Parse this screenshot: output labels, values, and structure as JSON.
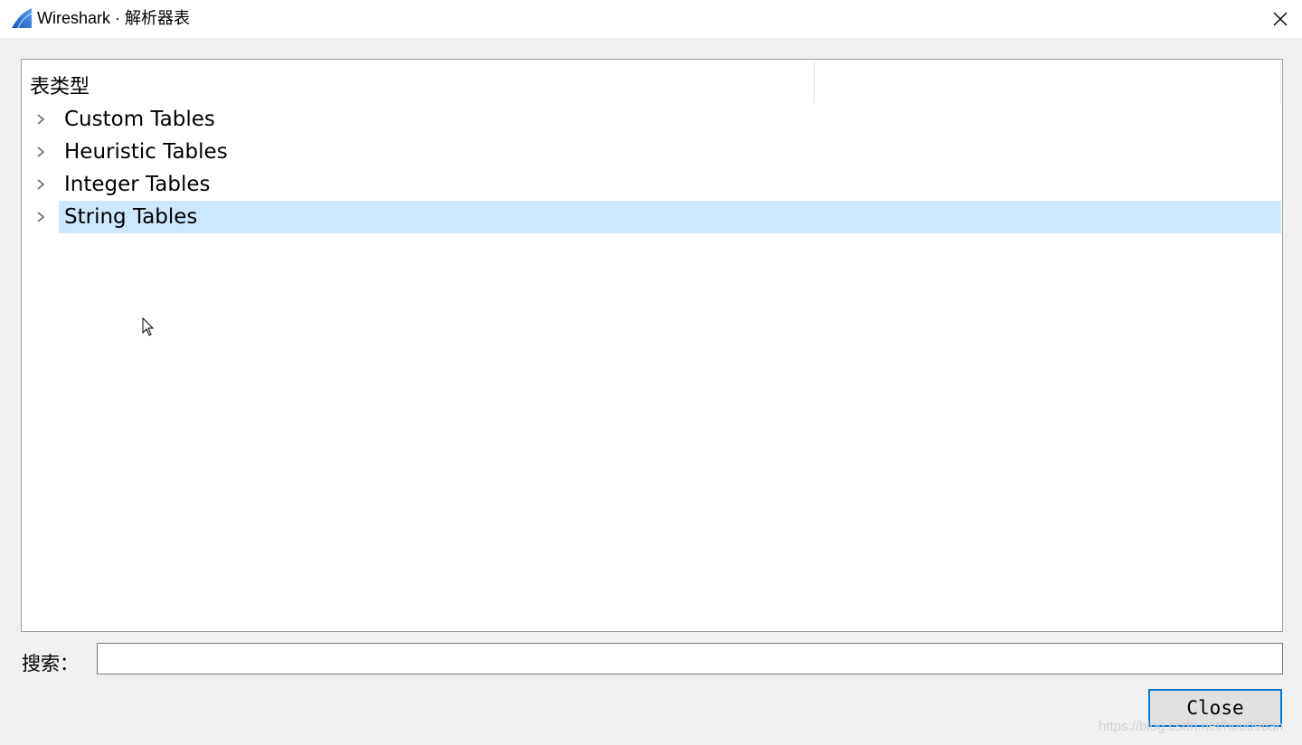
{
  "window": {
    "title": "Wireshark · 解析器表",
    "icon": "wireshark-fin-icon",
    "close_icon": "close-icon"
  },
  "tree": {
    "header": {
      "column1": "表类型",
      "column2": ""
    },
    "items": [
      {
        "label": "Custom Tables",
        "expanded": false,
        "selected": false
      },
      {
        "label": "Heuristic Tables",
        "expanded": false,
        "selected": false
      },
      {
        "label": "Integer Tables",
        "expanded": false,
        "selected": false
      },
      {
        "label": "String Tables",
        "expanded": false,
        "selected": true
      }
    ]
  },
  "search": {
    "label": "搜索：",
    "value": "",
    "placeholder": ""
  },
  "buttons": {
    "close_label": "Close"
  },
  "watermark": "https://blog.csdn.net/hou09tian",
  "colors": {
    "selection": "#cce8ff",
    "focus_border": "#0078d7",
    "dialog_bg": "#f0f0f0"
  }
}
